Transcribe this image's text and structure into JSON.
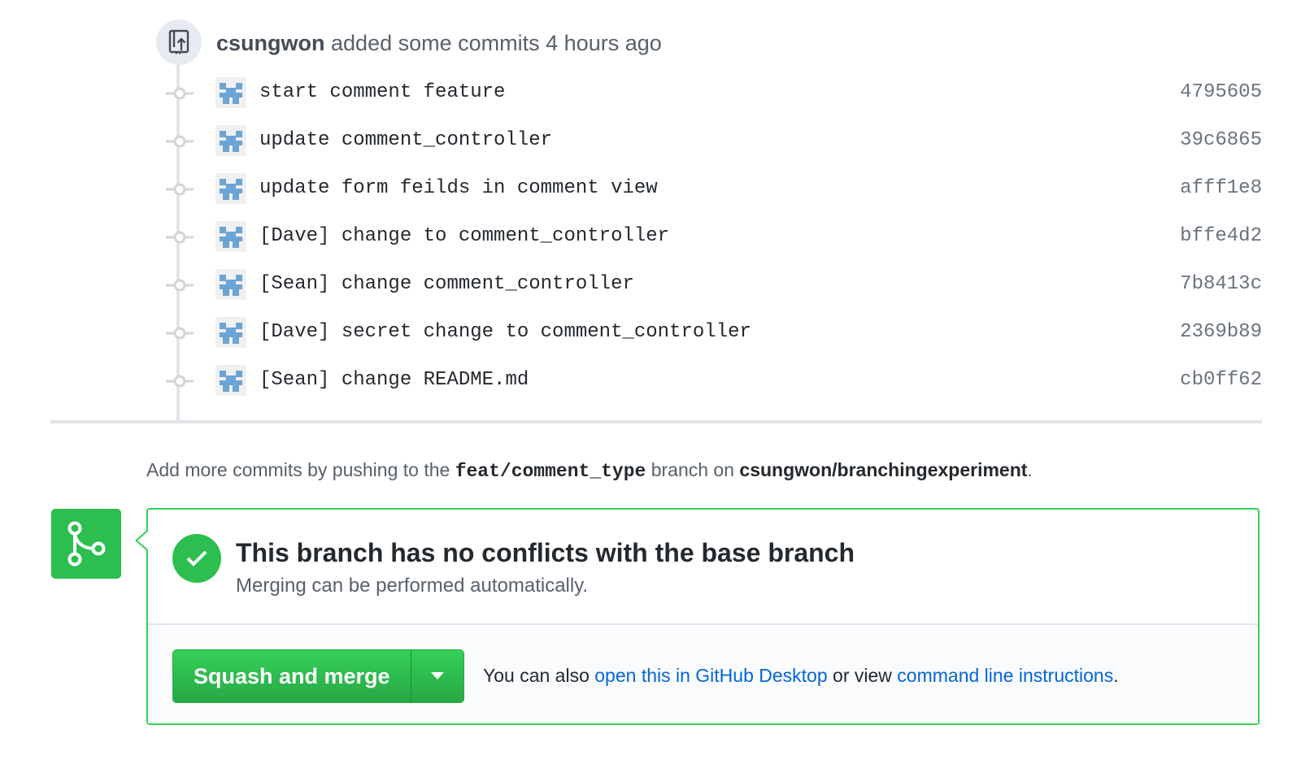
{
  "event": {
    "author": "csungwon",
    "action": "added some commits",
    "time": "4 hours ago",
    "icon": "repo-push-icon"
  },
  "commits": [
    {
      "message": "start comment feature",
      "sha": "4795605"
    },
    {
      "message": "update comment_controller",
      "sha": "39c6865"
    },
    {
      "message": "update form feilds in comment view",
      "sha": "afff1e8"
    },
    {
      "message": "[Dave] change to comment_controller",
      "sha": "bffe4d2"
    },
    {
      "message": "[Sean] change comment_controller",
      "sha": "7b8413c"
    },
    {
      "message": "[Dave] secret change to comment_controller",
      "sha": "2369b89"
    },
    {
      "message": "[Sean] change README.md",
      "sha": "cb0ff62"
    }
  ],
  "push_hint": {
    "prefix": "Add more commits by pushing to the",
    "branch": "feat/comment_type",
    "middle": "branch on",
    "repo": "csungwon/branchingexperiment",
    "suffix": "."
  },
  "merge": {
    "status_title": "This branch has no conflicts with the base branch",
    "status_subtitle": "Merging can be performed automatically.",
    "button_label": "Squash and merge",
    "also_prefix": "You can also",
    "desktop_link": "open this in GitHub Desktop",
    "or_view": "or view",
    "cli_link": "command line instructions",
    "suffix": "."
  },
  "colors": {
    "success_green": "#2cbe4e",
    "link_blue": "#0366d6",
    "avatar_blue": "#6aa5d6"
  }
}
